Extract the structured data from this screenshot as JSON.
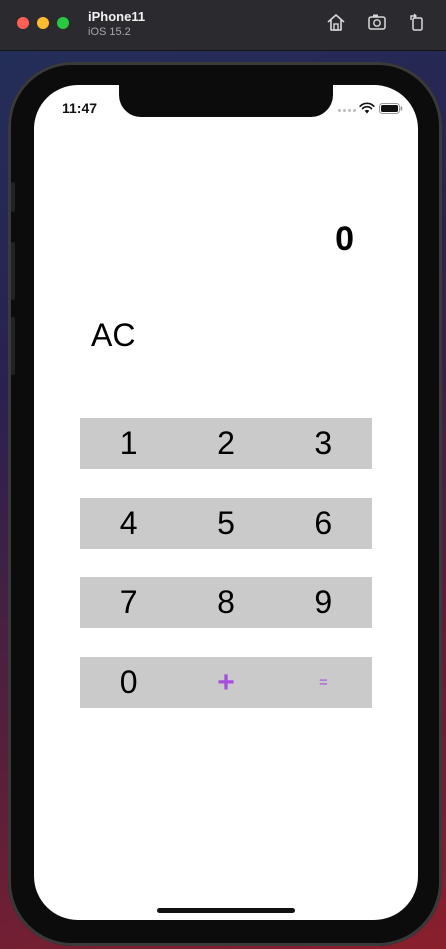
{
  "titlebar": {
    "device_name": "iPhone11",
    "os_version": "iOS 15.2",
    "icons": [
      "home-icon",
      "screenshot-icon",
      "rotate-icon"
    ]
  },
  "status_bar": {
    "time": "11:47",
    "icons": [
      "cellular-icon",
      "wifi-icon",
      "battery-icon"
    ]
  },
  "calculator": {
    "display_value": "0",
    "clear_label": "AC",
    "rows": [
      [
        "1",
        "2",
        "3"
      ],
      [
        "4",
        "5",
        "6"
      ],
      [
        "7",
        "8",
        "9"
      ],
      [
        "0",
        "+",
        "="
      ]
    ],
    "operator_color": "#a64ee0",
    "key_background": "#cacacb"
  }
}
